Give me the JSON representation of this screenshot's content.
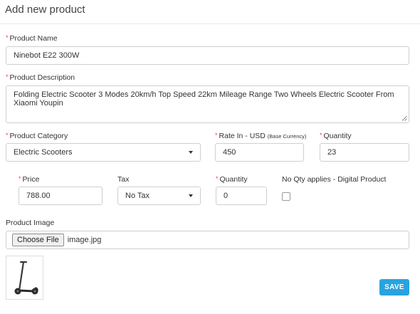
{
  "page": {
    "title": "Add new product"
  },
  "product_name": {
    "label": "Product Name",
    "value": "Ninebot E22 300W"
  },
  "product_description": {
    "label": "Product Description",
    "value": "Folding Electric Scooter 3 Modes 20km/h Top Speed 22km Mileage Range Two Wheels Electric Scooter From Xiaomi Youpin"
  },
  "product_category": {
    "label": "Product Category",
    "value": "Electric Scooters"
  },
  "rate": {
    "label": "Rate In - USD",
    "sublabel": "(Base Currency)",
    "value": "450"
  },
  "quantity_top": {
    "label": "Quantity",
    "value": "23"
  },
  "price": {
    "label": "Price",
    "value": "788.00"
  },
  "tax": {
    "label": "Tax",
    "value": "No Tax"
  },
  "quantity_bottom": {
    "label": "Quantity",
    "value": "0"
  },
  "digital_product": {
    "label": "No Qty applies - Digital Product",
    "checked": false
  },
  "product_image": {
    "label": "Product Image",
    "button": "Choose File",
    "filename": "image.jpg",
    "thumbnail_icon": "scooter-image"
  },
  "actions": {
    "save": "SAVE"
  },
  "colors": {
    "required": "#e74c3c",
    "accent": "#29a3e0",
    "border": "#cfcfcf"
  }
}
